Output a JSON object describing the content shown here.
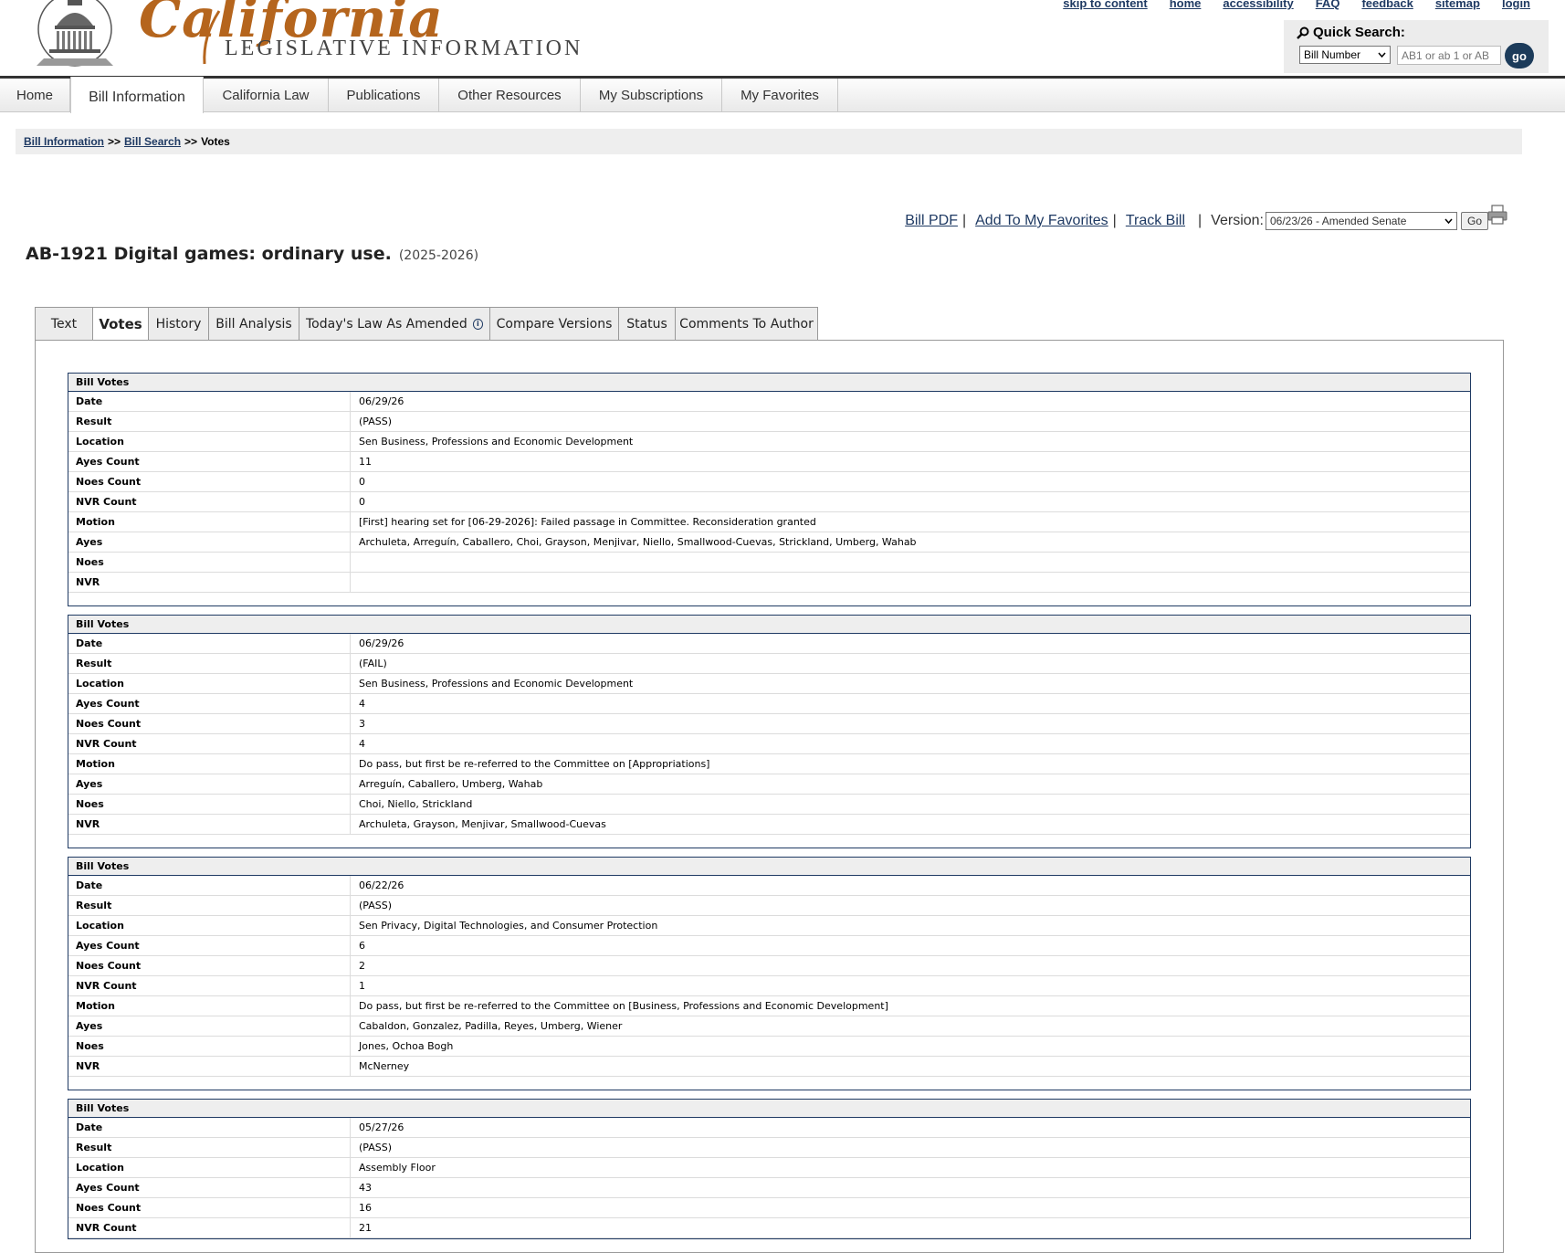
{
  "header": {
    "logo_script": "California",
    "logo_sub": "LEGISLATIVE INFORMATION",
    "util_links": [
      "skip to content",
      "home",
      "accessibility",
      "FAQ",
      "feedback",
      "sitemap",
      "login"
    ],
    "quick_search": {
      "title": "Quick Search:",
      "select_value": "Bill Number",
      "input_placeholder": "AB1 or ab 1 or AB",
      "go_label": "go"
    }
  },
  "nav": [
    "Home",
    "Bill Information",
    "California Law",
    "Publications",
    "Other Resources",
    "My Subscriptions",
    "My Favorites"
  ],
  "breadcrumb": {
    "items": [
      "Bill Information",
      "Bill Search"
    ],
    "current": "Votes",
    "separator": ">>"
  },
  "actions": {
    "bill_pdf": "Bill PDF",
    "add_favorites": "Add To My Favorites",
    "track_bill": "Track Bill",
    "version_label": "Version:",
    "version_value": "06/23/26 - Amended Senate",
    "go_label": "Go"
  },
  "bill": {
    "title": "AB-1921 Digital games: ordinary use.",
    "session": "(2025-2026)"
  },
  "tabs": [
    "Text",
    "Votes",
    "History",
    "Bill Analysis",
    "Today's Law As Amended",
    "Compare Versions",
    "Status",
    "Comments To Author"
  ],
  "labels": {
    "section": "Bill Votes",
    "date": "Date",
    "result": "Result",
    "location": "Location",
    "ayes_count": "Ayes Count",
    "noes_count": "Noes Count",
    "nvr_count": "NVR Count",
    "motion": "Motion",
    "ayes": "Ayes",
    "noes": "Noes",
    "nvr": "NVR"
  },
  "votes": [
    {
      "date": "06/29/26",
      "result": "(PASS)",
      "location": "Sen Business, Professions and Economic Development",
      "ayes_count": "11",
      "noes_count": "0",
      "nvr_count": "0",
      "motion": "[First] hearing set for [06-29-2026]: Failed passage in Committee. Reconsideration granted",
      "ayes": "Archuleta, Arreguín, Caballero, Choi, Grayson, Menjivar, Niello, Smallwood-Cuevas, Strickland, Umberg, Wahab",
      "noes": "",
      "nvr": ""
    },
    {
      "date": "06/29/26",
      "result": "(FAIL)",
      "location": "Sen Business, Professions and Economic Development",
      "ayes_count": "4",
      "noes_count": "3",
      "nvr_count": "4",
      "motion": "Do pass, but first be re-referred to the Committee on [Appropriations]",
      "ayes": "Arreguín, Caballero, Umberg, Wahab",
      "noes": "Choi, Niello, Strickland",
      "nvr": "Archuleta, Grayson, Menjivar, Smallwood-Cuevas"
    },
    {
      "date": "06/22/26",
      "result": "(PASS)",
      "location": "Sen Privacy, Digital Technologies, and Consumer Protection",
      "ayes_count": "6",
      "noes_count": "2",
      "nvr_count": "1",
      "motion": "Do pass, but first be re-referred to the Committee on [Business, Professions and Economic Development]",
      "ayes": "Cabaldon, Gonzalez, Padilla, Reyes, Umberg, Wiener",
      "noes": "Jones, Ochoa Bogh",
      "nvr": "McNerney"
    },
    {
      "date": "05/27/26",
      "result": "(PASS)",
      "location": "Assembly Floor",
      "ayes_count": "43",
      "noes_count": "16",
      "nvr_count": "21"
    }
  ]
}
